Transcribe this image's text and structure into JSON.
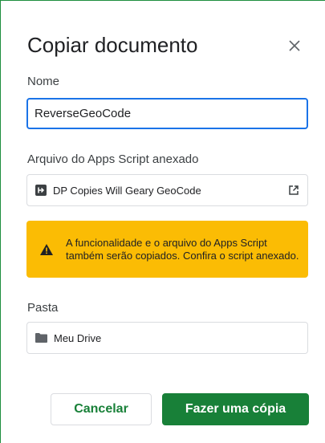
{
  "dialog": {
    "title": "Copiar documento",
    "close_icon": "close-icon"
  },
  "name_field": {
    "label": "Nome",
    "value": "ReverseGeoCode"
  },
  "script_field": {
    "label": "Arquivo do Apps Script anexado",
    "value": "DP Copies Will Geary GeoCode",
    "icon": "apps-script-icon",
    "action_icon": "open-in-new-icon"
  },
  "warning": {
    "text": "A funcionalidade e o arquivo do Apps Script também serão copiados. Confira o script anexado.",
    "icon": "warning-icon",
    "color": "#fbbc04"
  },
  "folder_field": {
    "label": "Pasta",
    "value": "Meu Drive",
    "icon": "folder-icon"
  },
  "buttons": {
    "cancel_label": "Cancelar",
    "copy_label": "Fazer uma cópia",
    "accent_color": "#188038"
  }
}
